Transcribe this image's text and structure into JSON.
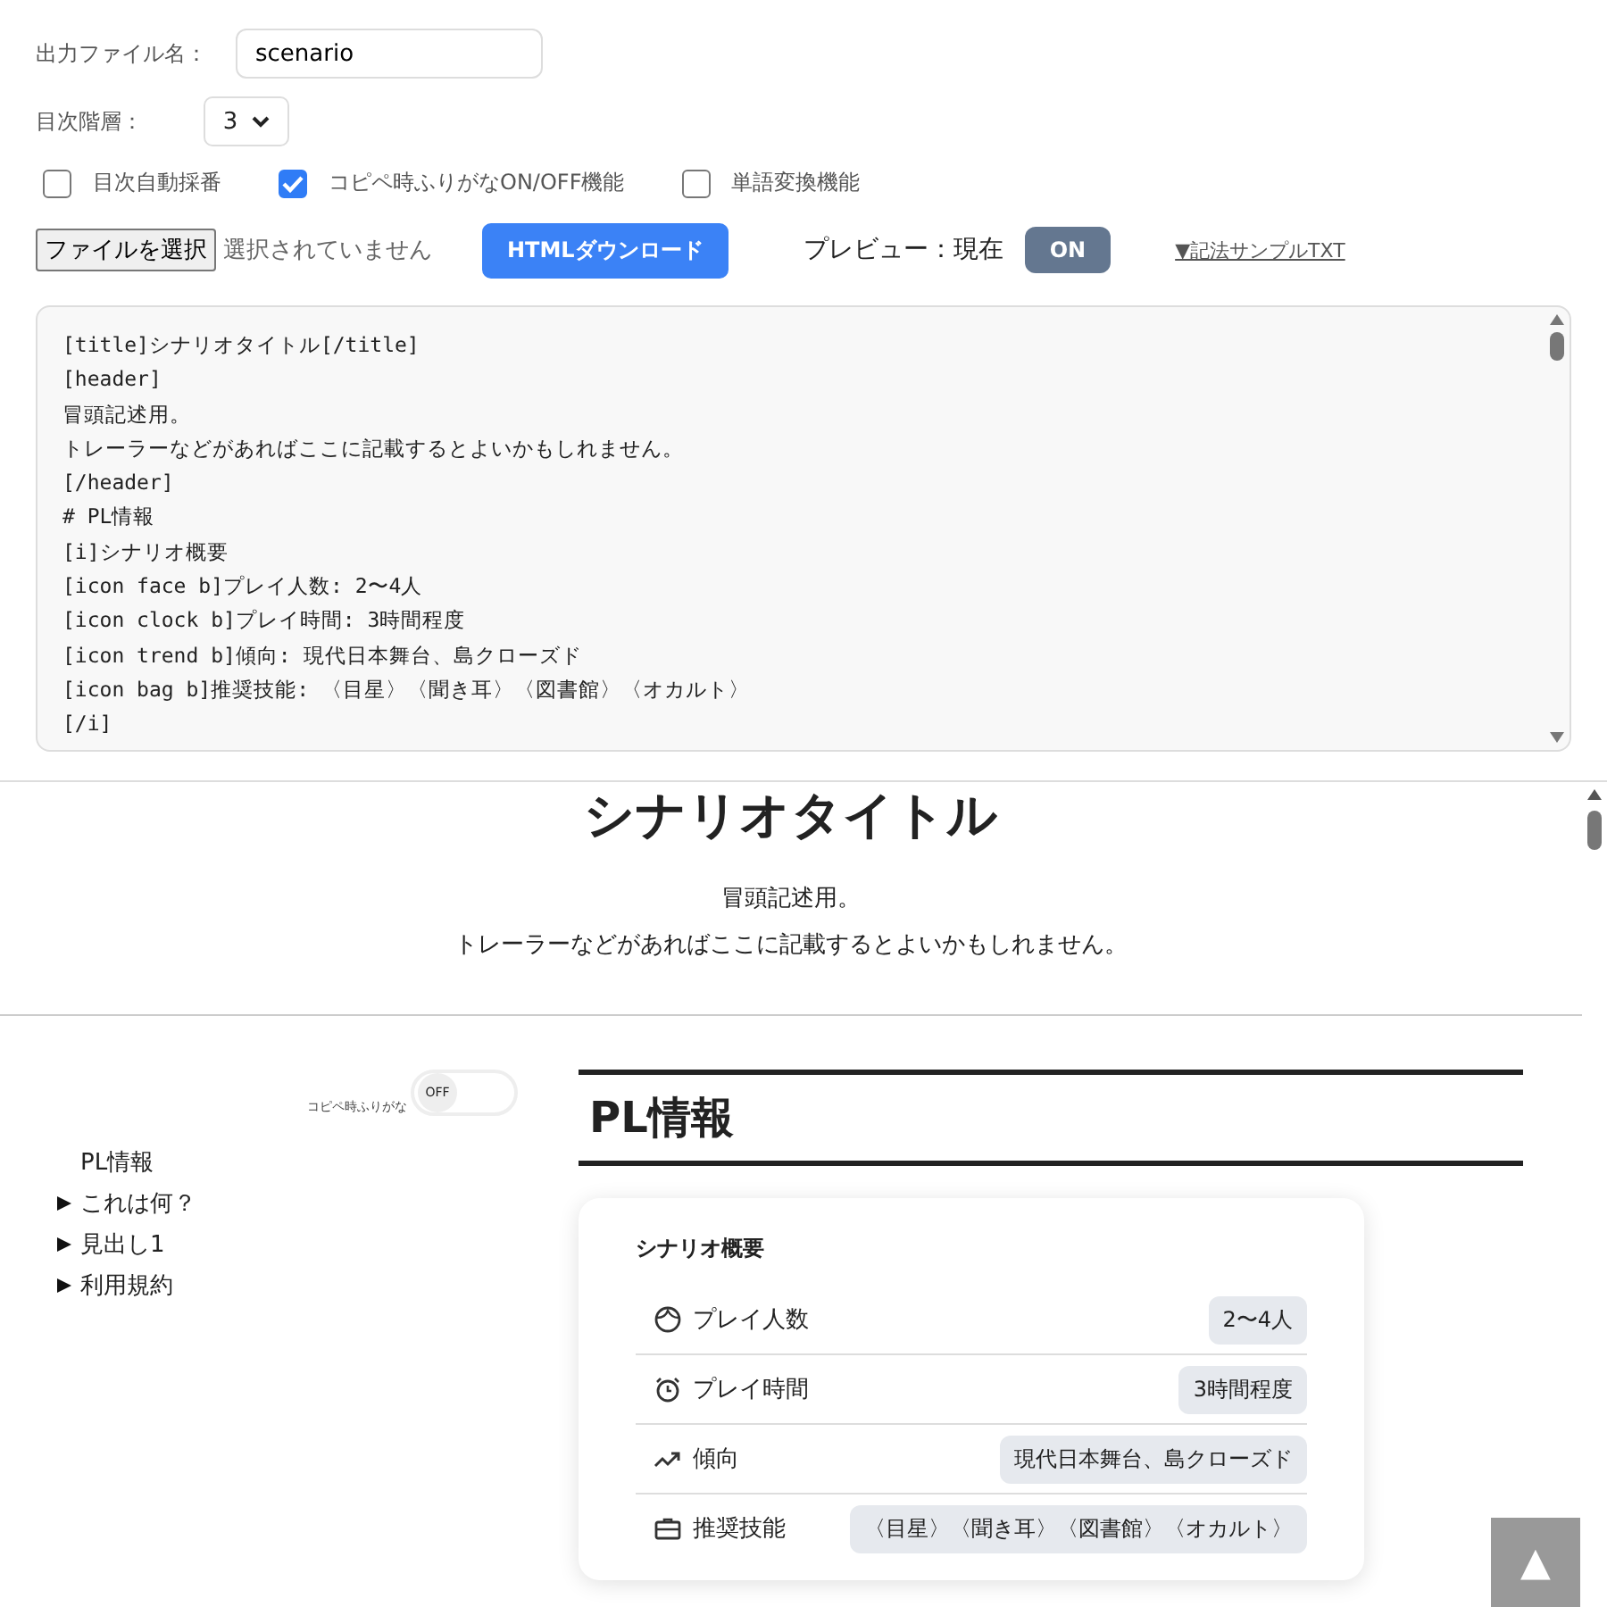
{
  "settings": {
    "filename_label": "出力ファイル名：",
    "filename": "scenario",
    "toc_depth_label": "目次階層：",
    "toc_depth": "3",
    "options": [
      {
        "label": "目次自動採番",
        "checked": false
      },
      {
        "label": "コピペ時ふりがなON/OFF機能",
        "checked": true
      },
      {
        "label": "単語変換機能",
        "checked": false
      }
    ]
  },
  "toolbar": {
    "file_button": "ファイルを選択",
    "file_status": "選択されていません",
    "download_button": "HTMLダウンロード",
    "preview_label": "プレビュー：現在",
    "preview_toggle": {
      "label": "ON",
      "on": true
    },
    "sample_link": "▼記法サンプルTXT"
  },
  "editor": {
    "lines": [
      "[title]シナリオタイトル[/title]",
      "[header]",
      "冒頭記述用。",
      "トレーラーなどがあればここに記載するとよいかもしれません。",
      "[/header]",
      "# PL情報",
      "[i]シナリオ概要",
      "[icon face b]プレイ人数: 2〜4人",
      "[icon clock b]プレイ時間: 3時間程度",
      "[icon trend b]傾向: 現代日本舞台、島クローズド",
      "[icon bag b]推奨技能: 〈目星〉〈聞き耳〉〈図書館〉〈オカルト〉",
      "[/i]"
    ]
  },
  "preview": {
    "title": "シナリオタイトル",
    "header_lines": [
      "冒頭記述用。",
      "トレーラーなどがあればここに記載するとよいかもしれません。"
    ],
    "furigana_toggle": {
      "caption": "コピペ時ふりがな",
      "label": "OFF",
      "on": false
    },
    "toc": [
      {
        "label": "PL情報",
        "expandable": false
      },
      {
        "label": "これは何？",
        "expandable": true
      },
      {
        "label": "見出し1",
        "expandable": true
      },
      {
        "label": "利用規約",
        "expandable": true
      }
    ],
    "section_heading": "PL情報",
    "card": {
      "title": "シナリオ概要",
      "rows": [
        {
          "label": "プレイ人数",
          "value": "2〜4人"
        },
        {
          "label": "プレイ時間",
          "value": "3時間程度"
        },
        {
          "label": "傾向",
          "value": "現代日本舞台、島クローズド"
        },
        {
          "label": "推奨技能",
          "value": "〈目星〉〈聞き耳〉〈図書館〉〈オカルト〉"
        }
      ]
    },
    "back_to_top": "▲"
  }
}
